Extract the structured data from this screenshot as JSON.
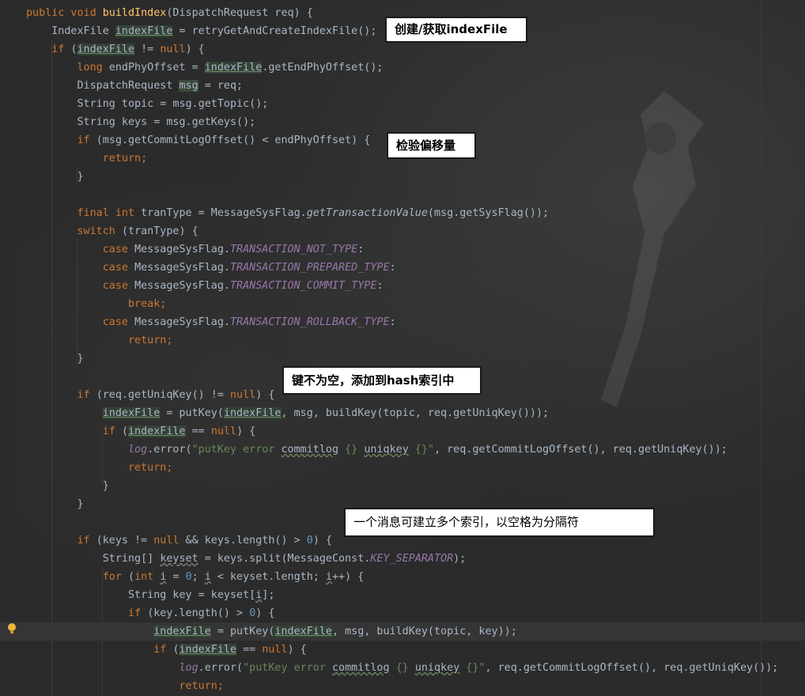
{
  "editor": {
    "theme_colors": {
      "background": "#2b2b2b",
      "keyword": "#cc7832",
      "method_decl": "#ffc66d",
      "constant": "#9876aa",
      "number": "#6897bb",
      "string": "#6a8759",
      "plain": "#a9b7c6"
    },
    "gutter_icon": "lightbulb-icon",
    "lines": [
      [
        [
          "kw",
          "public void "
        ],
        [
          "fn",
          "buildIndex"
        ],
        [
          "",
          "(DispatchRequest req) {"
        ]
      ],
      [
        [
          "",
          "    IndexFile "
        ],
        [
          "hl",
          "indexFile"
        ],
        [
          "",
          " = retryGetAndCreateIndexFile();"
        ]
      ],
      [
        [
          "kw",
          "    if "
        ],
        [
          "",
          "("
        ],
        [
          "hl",
          "indexFile"
        ],
        [
          "",
          " != "
        ],
        [
          "kw",
          "null"
        ],
        [
          "",
          ") {"
        ]
      ],
      [
        [
          "kw",
          "        long "
        ],
        [
          "",
          "endPhyOffset = "
        ],
        [
          "hl",
          "indexFile"
        ],
        [
          "",
          ".getEndPhyOffset();"
        ]
      ],
      [
        [
          "",
          "        DispatchRequest "
        ],
        [
          "hl2",
          "msg"
        ],
        [
          "",
          " = req;"
        ]
      ],
      [
        [
          "",
          "        String topic = msg.getTopic();"
        ]
      ],
      [
        [
          "",
          "        String keys = msg.getKeys();"
        ]
      ],
      [
        [
          "kw",
          "        if "
        ],
        [
          "",
          "(msg.getCommitLogOffset() < endPhyOffset) {"
        ]
      ],
      [
        [
          "kw",
          "            return;"
        ]
      ],
      [
        [
          "",
          "        }"
        ]
      ],
      [
        [
          "",
          ""
        ]
      ],
      [
        [
          "kw",
          "        final int "
        ],
        [
          "",
          "tranType = MessageSysFlag."
        ],
        [
          "italic",
          "getTransactionValue"
        ],
        [
          "",
          "(msg.getSysFlag());"
        ]
      ],
      [
        [
          "kw",
          "        switch "
        ],
        [
          "",
          "(tranType) {"
        ]
      ],
      [
        [
          "kw",
          "            case "
        ],
        [
          "",
          "MessageSysFlag."
        ],
        [
          "cst",
          "TRANSACTION_NOT_TYPE"
        ],
        [
          "",
          ":"
        ]
      ],
      [
        [
          "kw",
          "            case "
        ],
        [
          "",
          "MessageSysFlag."
        ],
        [
          "cst",
          "TRANSACTION_PREPARED_TYPE"
        ],
        [
          "",
          ":"
        ]
      ],
      [
        [
          "kw",
          "            case "
        ],
        [
          "",
          "MessageSysFlag."
        ],
        [
          "cst",
          "TRANSACTION_COMMIT_TYPE"
        ],
        [
          "",
          ":"
        ]
      ],
      [
        [
          "kw",
          "                break;"
        ]
      ],
      [
        [
          "kw",
          "            case "
        ],
        [
          "",
          "MessageSysFlag."
        ],
        [
          "cst",
          "TRANSACTION_ROLLBACK_TYPE"
        ],
        [
          "",
          ":"
        ]
      ],
      [
        [
          "kw",
          "                return;"
        ]
      ],
      [
        [
          "",
          "        }"
        ]
      ],
      [
        [
          "",
          ""
        ]
      ],
      [
        [
          "kw",
          "        if "
        ],
        [
          "",
          "(req.getUniqKey() != "
        ],
        [
          "kw",
          "null"
        ],
        [
          "",
          ") {"
        ]
      ],
      [
        [
          "",
          "            "
        ],
        [
          "hl",
          "indexFile"
        ],
        [
          "",
          " = putKey("
        ],
        [
          "hl",
          "indexFile"
        ],
        [
          "",
          ", msg, buildKey(topic, req.getUniqKey()));"
        ]
      ],
      [
        [
          "kw",
          "            if "
        ],
        [
          "",
          "("
        ],
        [
          "hl",
          "indexFile"
        ],
        [
          "",
          " == "
        ],
        [
          "kw",
          "null"
        ],
        [
          "",
          ") {"
        ]
      ],
      [
        [
          "",
          "                "
        ],
        [
          "lg",
          "log"
        ],
        [
          "",
          ".error("
        ],
        [
          "str",
          "\"putKey error "
        ],
        [
          "wavy",
          "commitlog"
        ],
        [
          "str",
          " {} "
        ],
        [
          "wavy",
          "uniqkey"
        ],
        [
          "str",
          " {}\""
        ],
        [
          "",
          ", req.getCommitLogOffset(), req.getUniqKey());"
        ]
      ],
      [
        [
          "kw",
          "                return;"
        ]
      ],
      [
        [
          "",
          "            }"
        ]
      ],
      [
        [
          "",
          "        }"
        ]
      ],
      [
        [
          "",
          ""
        ]
      ],
      [
        [
          "kw",
          "        if "
        ],
        [
          "",
          "(keys != "
        ],
        [
          "kw",
          "null"
        ],
        [
          "",
          " && keys.length() > "
        ],
        [
          "num",
          "0"
        ],
        [
          "",
          ") {"
        ]
      ],
      [
        [
          "",
          "            String[] "
        ],
        [
          "wavy2",
          "keyset"
        ],
        [
          "",
          " = keys.split(MessageConst."
        ],
        [
          "cst",
          "KEY_SEPARATOR"
        ],
        [
          "",
          ");"
        ]
      ],
      [
        [
          "kw",
          "            for "
        ],
        [
          "",
          "("
        ],
        [
          "kw",
          "int "
        ],
        [
          "wavy2",
          "i"
        ],
        [
          "",
          " = "
        ],
        [
          "num",
          "0"
        ],
        [
          "",
          "; "
        ],
        [
          "wavy2",
          "i"
        ],
        [
          "",
          " < keyset.length; "
        ],
        [
          "wavy2",
          "i"
        ],
        [
          "",
          "++) {"
        ]
      ],
      [
        [
          "",
          "                String key = keyset["
        ],
        [
          "wavy2",
          "i"
        ],
        [
          "",
          "];"
        ]
      ],
      [
        [
          "kw",
          "                if "
        ],
        [
          "",
          "(key.length() > "
        ],
        [
          "num",
          "0"
        ],
        [
          "",
          ") {"
        ]
      ],
      [
        [
          "",
          "                    "
        ],
        [
          "hl",
          "indexFile"
        ],
        [
          "",
          " = putKey("
        ],
        [
          "hl",
          "indexFile"
        ],
        [
          "",
          ", msg, buildKey(topic, key));"
        ]
      ],
      [
        [
          "kw",
          "                    if "
        ],
        [
          "",
          "("
        ],
        [
          "hl",
          "indexFile"
        ],
        [
          "",
          " == "
        ],
        [
          "kw",
          "null"
        ],
        [
          "",
          ") {"
        ]
      ],
      [
        [
          "",
          "                        "
        ],
        [
          "lg",
          "log"
        ],
        [
          "",
          ".error("
        ],
        [
          "str",
          "\"putKey error "
        ],
        [
          "wavy",
          "commitlog"
        ],
        [
          "str",
          " {} "
        ],
        [
          "wavy",
          "uniqkey"
        ],
        [
          "str",
          " {}\""
        ],
        [
          "",
          ", req.getCommitLogOffset(), req.getUniqKey());"
        ]
      ],
      [
        [
          "kw",
          "                        return;"
        ]
      ]
    ]
  },
  "annotations": {
    "create_index": "创建/获取indexFile",
    "check_offset": "检验偏移量",
    "key_not_empty": "键不为空，添加到hash索引中",
    "multi_index": "一个消息可建立多个索引，以空格为分隔符"
  }
}
